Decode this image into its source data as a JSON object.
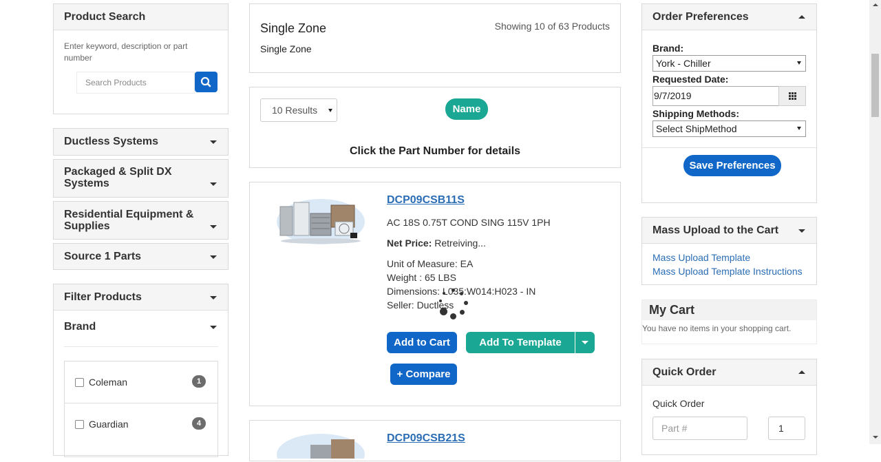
{
  "product_search": {
    "title": "Product Search",
    "hint": "Enter keyword, description or part number",
    "placeholder": "Search Products"
  },
  "categories": [
    {
      "label": "Ductless Systems"
    },
    {
      "label": "Packaged & Split DX Systems"
    },
    {
      "label": "Residential Equipment & Supplies"
    },
    {
      "label": "Source 1 Parts"
    }
  ],
  "filter": {
    "title": "Filter Products",
    "brand_title": "Brand",
    "brands": [
      {
        "name": "Coleman",
        "count": "1"
      },
      {
        "name": "Guardian",
        "count": "4"
      }
    ]
  },
  "zone": {
    "title": "Single Zone",
    "subtitle": "Single Zone",
    "showing": "Showing 10 of 63 Products"
  },
  "toolbar": {
    "results_select": "10 Results",
    "sort_label": "Name",
    "instruction": "Click the Part Number for details"
  },
  "products": [
    {
      "part_number": "DCP09CSB11S",
      "description": "AC 18S 0.75T COND SING 115V 1PH",
      "net_price_label": "Net Price:",
      "net_price_value": "Retreiving...",
      "unit": "Unit of Measure: EA",
      "weight": "Weight : 65 LBS",
      "dimensions": "Dimensions: L035:W014:H023 - IN",
      "seller": "Seller: Ductless",
      "add_to_cart": "Add to Cart",
      "add_to_template": "Add To Template",
      "compare": "+ Compare"
    },
    {
      "part_number": "DCP09CSB21S"
    }
  ],
  "order_prefs": {
    "title": "Order Preferences",
    "brand_label": "Brand:",
    "brand_value": "York - Chiller",
    "date_label": "Requested Date:",
    "date_value": "9/7/2019",
    "ship_label": "Shipping Methods:",
    "ship_value": "Select ShipMethod",
    "save": "Save Preferences"
  },
  "mass_upload": {
    "title": "Mass Upload to the Cart",
    "link1": "Mass Upload Template",
    "link2": "Mass Upload Template Instructions"
  },
  "cart": {
    "title": "My Cart",
    "empty": "You have no items in your shopping cart."
  },
  "quick_order": {
    "title": "Quick Order",
    "label": "Quick Order",
    "part_placeholder": "Part #",
    "qty_value": "1"
  },
  "colors": {
    "primary": "#1167c7",
    "teal": "#1aa793",
    "link": "#2a6db5"
  }
}
